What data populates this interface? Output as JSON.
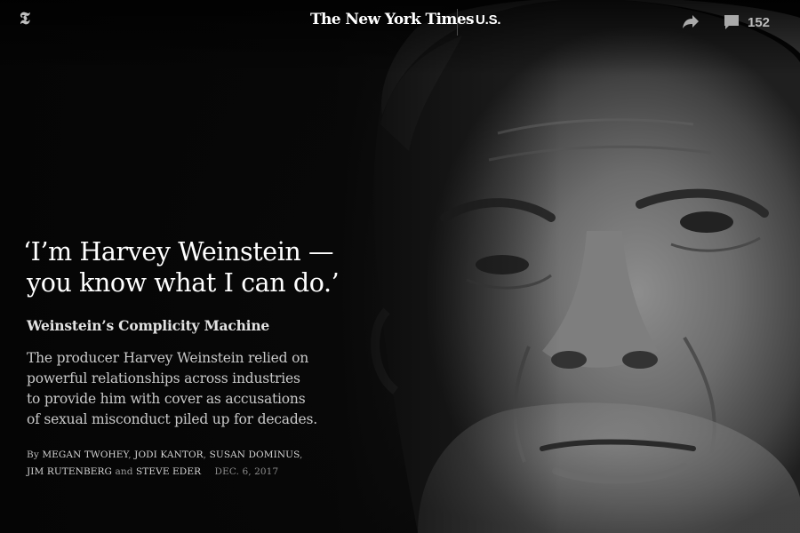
{
  "header": {
    "logo_glyph": "𝕿",
    "masthead": "The New York Times",
    "section": "U.S.",
    "comments_count": "152",
    "icons": {
      "share": "share-icon",
      "comments": "comment-bubble-icon"
    }
  },
  "article": {
    "headline_line1": "‘I’m Harvey Weinstein —",
    "headline_line2": "you know what I can do.’",
    "kicker": "Weinstein’s Complicity Machine",
    "summary_lines": [
      "The producer Harvey Weinstein relied on",
      "powerful relationships across industries",
      "to provide him with cover as accusations",
      "of sexual misconduct piled up for decades."
    ],
    "byline": {
      "by": "By",
      "authors": [
        "MEGAN TWOHEY",
        "JODI KANTOR",
        "SUSAN DOMINUS",
        "JIM RUTENBERG",
        "STEVE EDER"
      ],
      "and": "and",
      "date": "DEC. 6, 2017"
    }
  },
  "colors": {
    "background": "#0b0b0b",
    "text": "#ffffff",
    "muted": "#c9c9c9"
  }
}
